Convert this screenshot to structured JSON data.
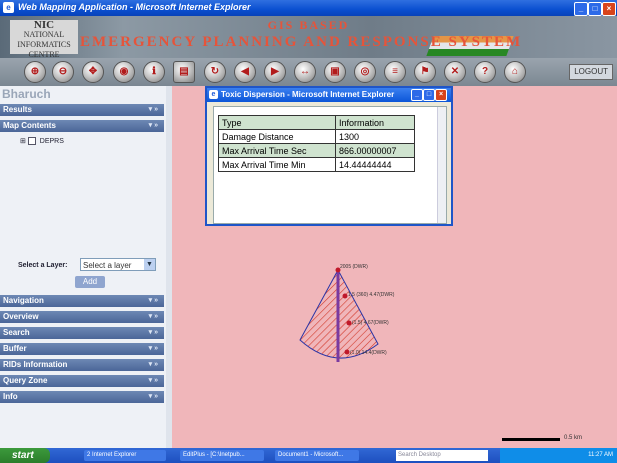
{
  "window": {
    "title": "Web Mapping Application - Microsoft Internet Explorer"
  },
  "banner": {
    "logo_top": "NIC",
    "logo_sub": "NATIONAL INFORMATICS CENTRE",
    "title_line1": "GIS BASED",
    "title_line2": "EMERGENCY PLANNING AND RESPONSE SYSTEM"
  },
  "toolbar": {
    "logout": "LOGOUT"
  },
  "left": {
    "city": "Bharuch",
    "sections": [
      "Results",
      "Map Contents",
      "Navigation",
      "Overview",
      "Search",
      "Buffer",
      "RIDs Information",
      "Query Zone",
      "Info"
    ],
    "tree_item": "DEPRS",
    "select_label": "Select a Layer:",
    "select_value": "Select a layer",
    "add_button": "Add"
  },
  "popup": {
    "title": "Toxic Dispersion - Microsoft Internet Explorer",
    "headers": [
      "Type",
      "Information"
    ],
    "rows": [
      [
        "Damage Distance",
        "1300"
      ],
      [
        "Max Arrival Time Sec",
        "866.00000007"
      ],
      [
        "Max Arrival Time Min",
        "14.44444444"
      ]
    ]
  },
  "map": {
    "labels": [
      "2005 (DWR)",
      "1.5 (360) 4.47(DWR)",
      "(1.5) 4.67(DWR)",
      "(1.0) 14.4(DWR)"
    ],
    "scale_label": "0.5 km"
  },
  "taskbar": {
    "start": "start",
    "tasks": [
      "2 Internet Explorer",
      "EditPlus - [C:\\Inetpub...",
      "Document1 - Microsoft..."
    ],
    "search_placeholder": "Search Desktop",
    "clock": "11:27 AM"
  },
  "colors": {
    "map_bg": "#f0b6ba",
    "plume": "#d2382a",
    "titlebar": "#0a4fd0"
  }
}
